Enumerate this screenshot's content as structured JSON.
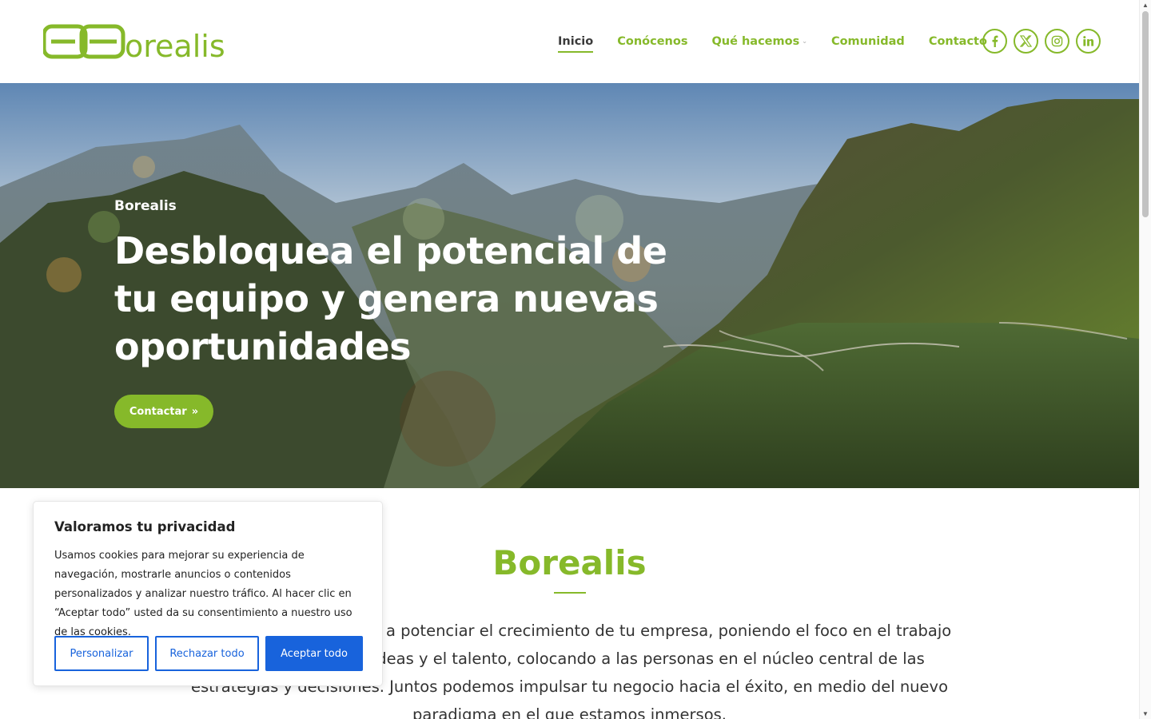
{
  "brand": {
    "name": "Borealis",
    "accent_color": "#86b92a"
  },
  "nav": {
    "items": [
      {
        "label": "Inicio",
        "active": true
      },
      {
        "label": "Conócenos",
        "active": false
      },
      {
        "label": "Qué hacemos",
        "active": false,
        "has_dropdown": true
      },
      {
        "label": "Comunidad",
        "active": false
      },
      {
        "label": "Contacto",
        "active": false
      }
    ],
    "social": [
      "facebook-icon",
      "x-icon",
      "instagram-icon",
      "linkedin-icon"
    ]
  },
  "hero": {
    "kicker": "Borealis",
    "title": "Desbloquea el potencial de tu equipo y genera nuevas oportunidades",
    "button_label": "Contactar"
  },
  "intro": {
    "title": "Borealis",
    "text": "En Borealis te ayudamos a potenciar el crecimiento de tu empresa, poniendo el foco en el trabajo con los equipos, las ideas y el talento, colocando a las personas en el núcleo central de las estrategias y decisiones. Juntos podemos impulsar tu negocio hacia el éxito, en medio del nuevo paradigma en el que estamos inmersos."
  },
  "cookie": {
    "title": "Valoramos tu privacidad",
    "text": "Usamos cookies para mejorar su experiencia de navegación, mostrarle anuncios o contenidos personalizados y analizar nuestro tráfico. Al hacer clic en “Aceptar todo” usted da su consentimiento a nuestro uso de las cookies.",
    "customize_label": "Personalizar",
    "reject_label": "Rechazar todo",
    "accept_label": "Aceptar todo",
    "button_color": "#1863dc"
  }
}
